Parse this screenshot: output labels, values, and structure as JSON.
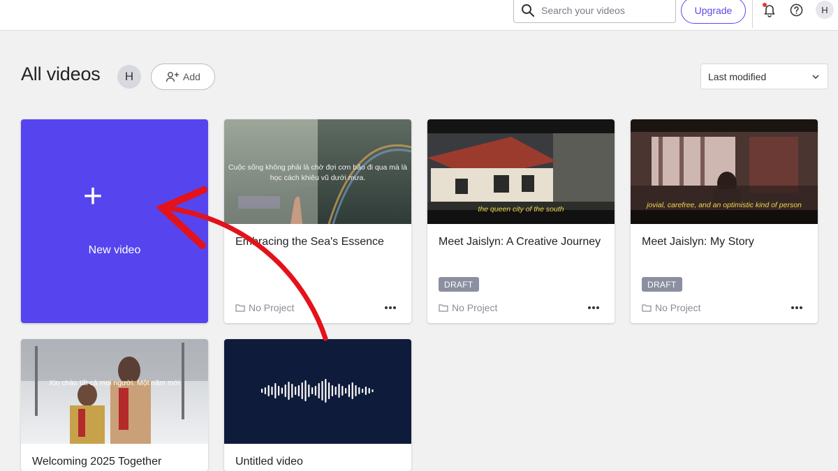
{
  "topbar": {
    "search_placeholder": "Search your videos",
    "upgrade_label": "Upgrade",
    "avatar_initial": "H"
  },
  "header": {
    "title": "All videos",
    "avatar_initial": "H",
    "add_label": "Add",
    "sort_value": "Last modified"
  },
  "new_video": {
    "label": "New video",
    "plus": "+"
  },
  "videos": [
    {
      "title": "Embracing the Sea's Essence",
      "caption": "Cuộc sống không phải là chờ đợi cơn bão đi qua mà là học cách khiêu vũ dưới mưa.",
      "project": "No Project",
      "badge": ""
    },
    {
      "title": "Meet Jaislyn: A Creative Journey",
      "caption": "the queen city of the south",
      "project": "No Project",
      "badge": "DRAFT"
    },
    {
      "title": "Meet Jaislyn: My Story",
      "caption": "jovial, carefree, and an optimistic kind of person",
      "project": "No Project",
      "badge": "DRAFT"
    },
    {
      "title": "Welcoming 2025 Together",
      "caption": "Xin chào tất cả mọi người. Một năm mới",
      "project": "",
      "badge": ""
    },
    {
      "title": "Untitled video",
      "caption": "",
      "project": "",
      "badge": ""
    }
  ],
  "colors": {
    "accent": "#5645ee",
    "annotation_arrow": "#e3121b",
    "audio_thumb_bg": "#0f1b3a",
    "draft_badge": "#8b8fa0"
  },
  "icons": [
    "search-icon",
    "bell-icon",
    "help-icon",
    "add-user-icon",
    "chevron-down-icon",
    "folder-icon",
    "more-icon",
    "plus-icon",
    "waveform-icon"
  ]
}
